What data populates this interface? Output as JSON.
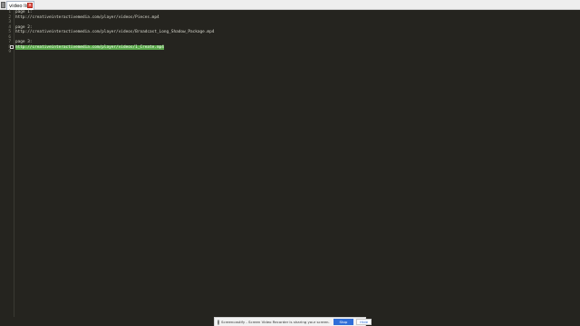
{
  "tab": {
    "label": "video list",
    "close": "×"
  },
  "lines": [
    {
      "num": "1",
      "text": "page 1:"
    },
    {
      "num": "2",
      "text": "http://creativeinteractivemedia.com/player/videos/Pieces.mp4"
    },
    {
      "num": "3",
      "text": ""
    },
    {
      "num": "4",
      "text": "page 2:"
    },
    {
      "num": "5",
      "text": "http://creativeinteractivemedia.com/player/videos/Broadcast_Long_Shadow_Package.mp4"
    },
    {
      "num": "6",
      "text": ""
    },
    {
      "num": "7",
      "text": "page 3:"
    },
    {
      "num": "8",
      "text": "http://creativeinteractivemedia.com/player/videos/1_Create.mp4",
      "selected": true
    },
    {
      "num": "9",
      "text": ""
    }
  ],
  "share_bar": {
    "message": "Screencastify - Screen Video Recorder is sharing your screen.",
    "stop_label": "Stop sharing",
    "hide_label": "Hide"
  },
  "colors": {
    "editor_bg": "#25241f",
    "selection": "#5aa84b",
    "accent": "#2f6ed8"
  }
}
